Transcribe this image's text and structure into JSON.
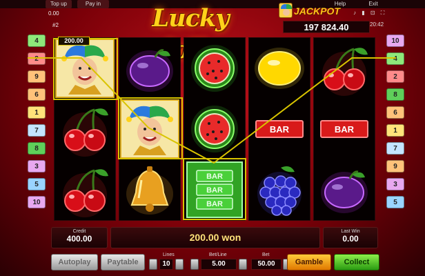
{
  "top_bar": {
    "top_up": "Top up",
    "pay_in": "Pay in",
    "help": "Help",
    "exit": "Exit",
    "balance": "0.00",
    "game_no": "#2"
  },
  "title": "Lucky Jolly",
  "jackpot": {
    "label": "JACKPOT",
    "value": "197 824.40"
  },
  "status_icons": "♪ ▮ ⊡ ⛶",
  "clock": "20:42",
  "left_lines": [
    "4",
    "2",
    "9",
    "6",
    "1",
    "7",
    "8",
    "3",
    "5",
    "10"
  ],
  "right_lines": [
    "10",
    "4",
    "2",
    "8",
    "6",
    "1",
    "7",
    "9",
    "3",
    "5"
  ],
  "reels": [
    [
      "joker",
      "cherry",
      "cherry"
    ],
    [
      "plum",
      "joker",
      "bell"
    ],
    [
      "watermelon",
      "watermelon",
      "bar3"
    ],
    [
      "lemon",
      "bar",
      "grapes"
    ],
    [
      "cherry",
      "bar",
      "plum"
    ]
  ],
  "bar_text": "BAR",
  "win_value": "200.00",
  "credit": {
    "label": "Credit",
    "value": "400.00"
  },
  "win_message": "200.00 won",
  "last_win": {
    "label": "Last Win",
    "value": "0.00"
  },
  "buttons": {
    "autoplay": "Autoplay",
    "paytable": "Paytable",
    "gamble": "Gamble",
    "collect": "Collect"
  },
  "lines": {
    "label": "Lines",
    "value": "10"
  },
  "bet_line": {
    "label": "Bet/Line",
    "value": "5.00"
  },
  "bet": {
    "label": "Bet",
    "value": "50.00"
  },
  "colors": {
    "accent_yellow": "#ffd21a",
    "background_red": "#b0101a",
    "payline": "#d9c400"
  }
}
